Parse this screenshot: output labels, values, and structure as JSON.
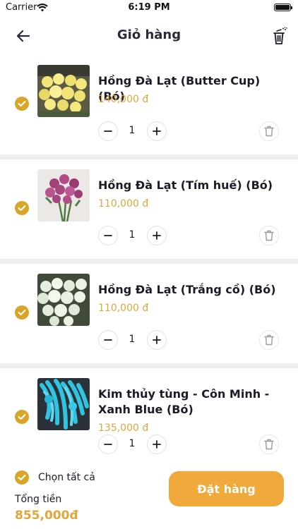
{
  "status": {
    "carrier": "Carrier",
    "time": "6:19 PM"
  },
  "header": {
    "title": "Giỏ hàng"
  },
  "colors": {
    "accent": "#d9a528",
    "price": "#e3a53a",
    "button": "#f2a93b",
    "divider": "#eeeeee"
  },
  "items": [
    {
      "name": "Hồng Đà Lạt (Butter Cup) (Bó)",
      "price": "140,000 đ",
      "qty": "1",
      "checked": true,
      "image": "yellow-roses"
    },
    {
      "name": "Hồng Đà Lạt (Tím huế) (Bó)",
      "price": "110,000 đ",
      "qty": "1",
      "checked": true,
      "image": "purple-roses"
    },
    {
      "name": "Hồng Đà Lạt (Trắng cồ) (Bó)",
      "price": "110,000 đ",
      "qty": "1",
      "checked": true,
      "image": "white-roses"
    },
    {
      "name": "Kim thủy tùng - Côn Minh - Xanh Blue (Bó)",
      "price": "135,000 đ",
      "qty": "1",
      "checked": true,
      "image": "blue-plant"
    }
  ],
  "footer": {
    "select_all_label": "Chọn tất cả",
    "total_label": "Tổng tiền",
    "total_value": "855,000đ",
    "order_label": "Đặt hàng"
  }
}
